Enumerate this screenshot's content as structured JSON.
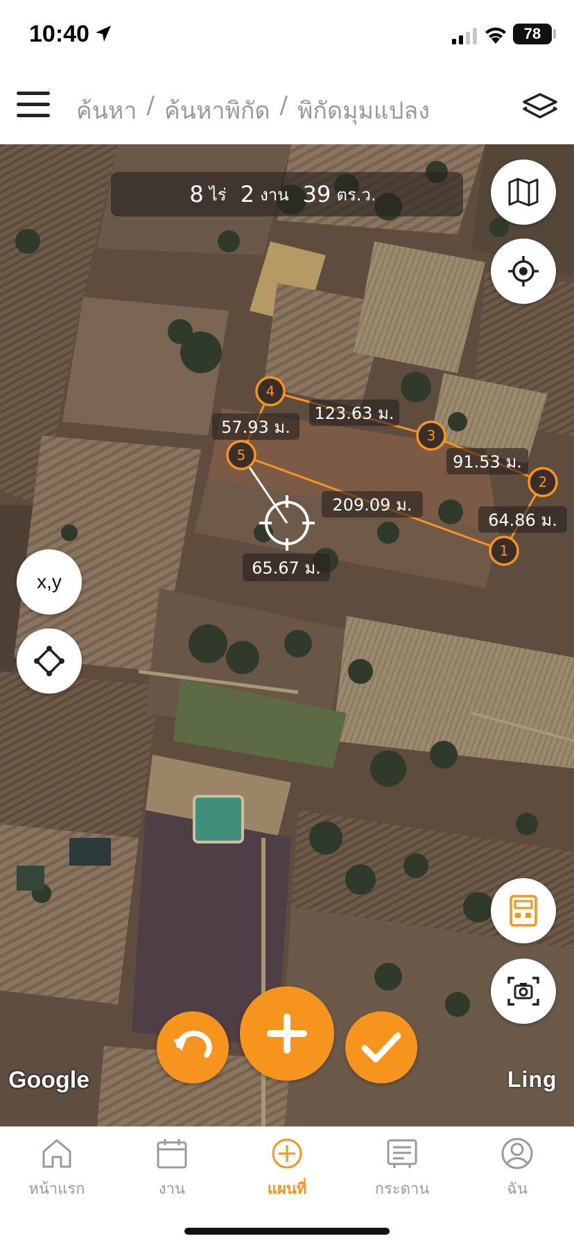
{
  "status_bar": {
    "time": "10:40",
    "battery": "78"
  },
  "header": {
    "breadcrumb": [
      "ค้นหา",
      "ค้นหาพิกัด",
      "พิกัดมุมแปลง"
    ],
    "separator": "/"
  },
  "map": {
    "area": {
      "rai_value": "8",
      "rai_unit": "ไร่",
      "ngan_value": "2",
      "ngan_unit": "งาน",
      "wa_value": "39",
      "wa_unit": "ตร.ว."
    },
    "points": [
      {
        "label": "1"
      },
      {
        "label": "2"
      },
      {
        "label": "3"
      },
      {
        "label": "4"
      },
      {
        "label": "5"
      }
    ],
    "distances": {
      "d_4_3": "123.63 ม.",
      "d_5_4": "57.93 ม.",
      "d_3_2": "91.53 ม.",
      "d_2_1": "64.86 ม.",
      "d_1_5": "209.09 ม.",
      "d_cursor": "65.67 ม."
    },
    "xy_button": "x,y",
    "attribution": "Google",
    "watermark": "Ling"
  },
  "nav": {
    "items": [
      {
        "label": "หน้าแรก"
      },
      {
        "label": "งาน"
      },
      {
        "label": "แผนที่"
      },
      {
        "label": "กระดาน"
      },
      {
        "label": "ฉัน"
      }
    ],
    "active_index": 2
  },
  "colors": {
    "accent": "#f7941d",
    "muted": "#9a9a9a"
  }
}
